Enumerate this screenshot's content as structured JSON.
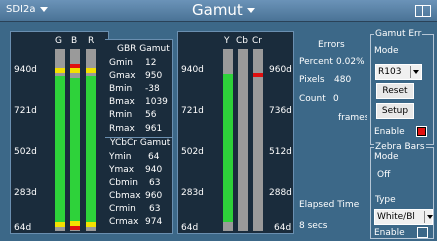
{
  "window": {
    "source": "SDI2a",
    "title": "Gamut"
  },
  "rgb_meter": {
    "scale": [
      "940d",
      "721d",
      "502d",
      "283d",
      "64d"
    ],
    "channels": [
      {
        "label": "G",
        "level": 0.955
      },
      {
        "label": "B",
        "level": 0.94
      },
      {
        "label": "R",
        "level": 0.955
      }
    ]
  },
  "gbr_gamut": {
    "header": "GBR Gamut",
    "rows": [
      {
        "label": "Gmin",
        "value": "12"
      },
      {
        "label": "Gmax",
        "value": "950"
      },
      {
        "label": "Bmin",
        "value": "-38"
      },
      {
        "label": "Bmax",
        "value": "1039"
      },
      {
        "label": "Rmin",
        "value": "56"
      },
      {
        "label": "Rmax",
        "value": "961"
      }
    ]
  },
  "ycbcr_gamut": {
    "header": "YCbCr Gamut",
    "rows": [
      {
        "label": "Ymin",
        "value": "64"
      },
      {
        "label": "Ymax",
        "value": "940"
      },
      {
        "label": "Cbmin",
        "value": "63"
      },
      {
        "label": "Cbmax",
        "value": "960"
      },
      {
        "label": "Crmin",
        "value": "63"
      },
      {
        "label": "Crmax",
        "value": "974"
      }
    ]
  },
  "ycbcr_meter": {
    "scale_left": [
      "940d",
      "721d",
      "502d",
      "283d",
      "64d"
    ],
    "scale_right": [
      "960d",
      "736d",
      "512d",
      "288d",
      "64d"
    ],
    "channels": [
      {
        "label": "Y",
        "level": 0.97
      },
      {
        "label": "Cb",
        "level": 0.0
      },
      {
        "label": "Cr",
        "level": 0.0
      }
    ]
  },
  "errors": {
    "header": "Errors",
    "percent_label": "Percent",
    "percent_value": "0.02%",
    "pixels_label": "Pixels",
    "pixels_value": "480",
    "count_label": "Count",
    "count_value": "0",
    "frames_label": "frames",
    "elapsed_label": "Elapsed Time",
    "elapsed_value": "8 secs"
  },
  "gamut_err": {
    "group_label": "Gamut Err",
    "mode_label": "Mode",
    "mode_value": "R103",
    "reset_label": "Reset",
    "setup_label": "Setup",
    "enable_label": "Enable",
    "enabled": true
  },
  "zebra": {
    "group_label": "Zebra Bars",
    "mode_label": "Mode",
    "mode_value": "Off",
    "type_label": "Type",
    "type_value": "White/Bl",
    "enable_label": "Enable",
    "enabled": false
  },
  "colors": {
    "fill_green": "#2ed23a",
    "cap_yellow": "#f4e000",
    "cap_red": "#e01010",
    "enable_red": "#e01010"
  }
}
